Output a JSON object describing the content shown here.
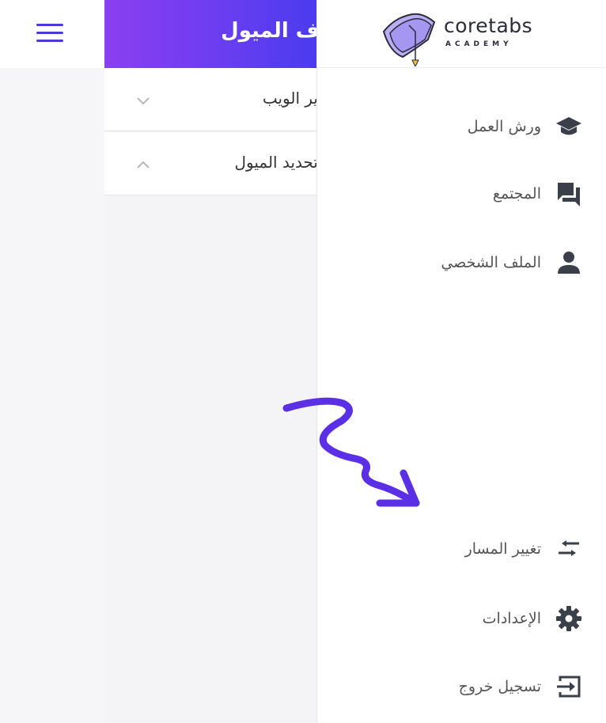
{
  "header": {
    "title": "ف الميول"
  },
  "accordion": [
    {
      "label": "ير الويب",
      "state": "collapsed"
    },
    {
      "label": "تحديد الميول",
      "state": "expanded"
    }
  ],
  "logo": {
    "name": "coretabs",
    "subtitle": "ACADEMY"
  },
  "nav_top": [
    {
      "label": "ورش العمل",
      "icon": "graduation-cap-icon"
    },
    {
      "label": "المجتمع",
      "icon": "forum-icon"
    },
    {
      "label": "الملف الشخصي",
      "icon": "person-icon"
    }
  ],
  "nav_bottom": [
    {
      "label": "تغيير المسار",
      "icon": "swap-arrows-icon"
    },
    {
      "label": "الإعدادات",
      "icon": "gear-icon"
    },
    {
      "label": "تسجيل خروج",
      "icon": "logout-icon"
    }
  ],
  "colors": {
    "accent": "#4a3ad8",
    "gradient_start": "#8a3ff0",
    "gradient_end": "#4b3bee",
    "icon": "#3a3f4a"
  }
}
